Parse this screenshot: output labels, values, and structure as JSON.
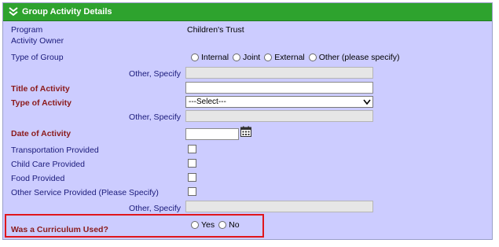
{
  "header": {
    "title": "Group Activity Details"
  },
  "fields": {
    "program": {
      "label": "Program",
      "value": "Children's Trust"
    },
    "activity_owner": {
      "label": "Activity Owner"
    },
    "type_of_group": {
      "label": "Type of Group",
      "options": [
        "Internal",
        "Joint",
        "External",
        "Other (please specify)"
      ]
    },
    "other_specify_1": {
      "label": "Other, Specify"
    },
    "title_of_activity": {
      "label": "Title of Activity",
      "value": ""
    },
    "type_of_activity": {
      "label": "Type of Activity",
      "selected": "---Select---"
    },
    "other_specify_2": {
      "label": "Other, Specify"
    },
    "date_of_activity": {
      "label": "Date of Activity",
      "value": ""
    },
    "transportation": {
      "label": "Transportation Provided"
    },
    "child_care": {
      "label": "Child Care Provided"
    },
    "food": {
      "label": "Food Provided"
    },
    "other_service": {
      "label": "Other Service Provided (Please Specify)"
    },
    "other_specify_3": {
      "label": "Other, Specify"
    },
    "curriculum": {
      "label": "Was a Curriculum Used?",
      "options": [
        "Yes",
        "No"
      ]
    }
  },
  "colors": {
    "header_bg": "#2ea32e",
    "panel_bg": "#ccccff",
    "label_color": "#1a1a7a",
    "required_color": "#8b1a1a",
    "highlight_border": "#e0161b"
  },
  "icons": {
    "collapse": "double-chevron-down-icon",
    "calendar": "calendar-icon",
    "dropdown": "chevron-down-icon"
  }
}
